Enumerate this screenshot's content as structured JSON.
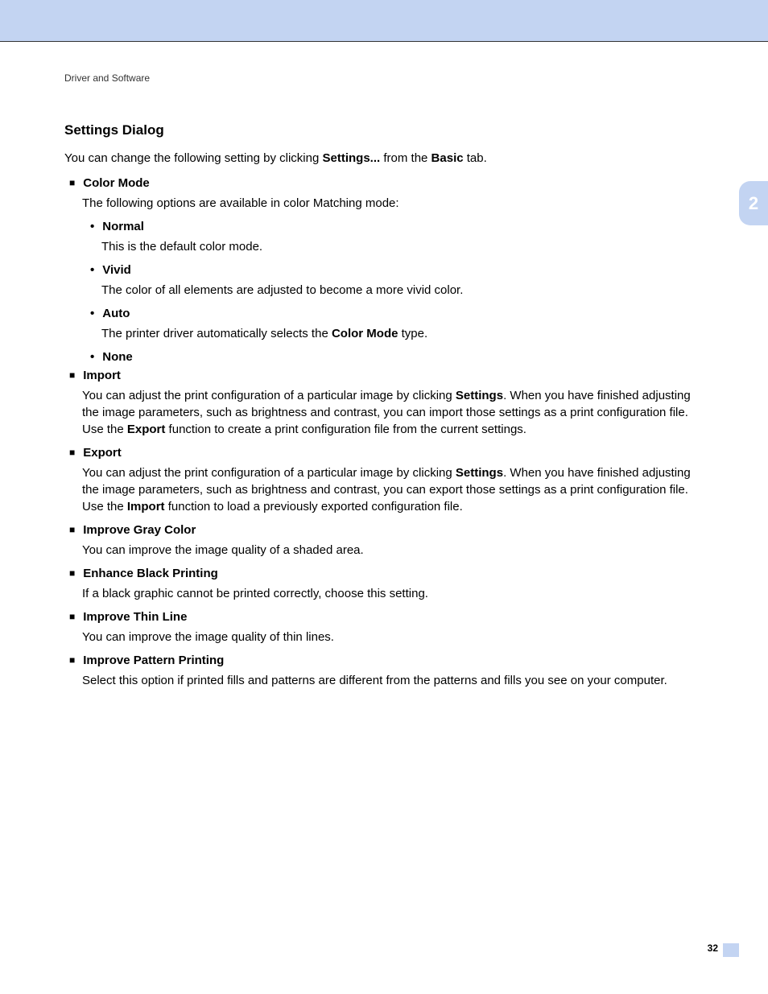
{
  "header": {
    "running": "Driver and Software"
  },
  "chapter_tab": "2",
  "page_number": "32",
  "section": {
    "title": "Settings Dialog",
    "intro": {
      "pre": "You can change the following setting by clicking ",
      "bold1": "Settings...",
      "mid": " from the ",
      "bold2": "Basic",
      "post": " tab."
    }
  },
  "items": {
    "color_mode": {
      "label": "Color Mode",
      "body": "The following options are available in color Matching mode:",
      "sub": {
        "normal": {
          "label": "Normal",
          "body": "This is the default color mode."
        },
        "vivid": {
          "label": "Vivid",
          "body": "The color of all elements are adjusted to become a more vivid color."
        },
        "auto": {
          "label": "Auto",
          "body_pre": "The printer driver automatically selects the ",
          "body_bold": "Color Mode",
          "body_post": " type."
        },
        "none": {
          "label": "None"
        }
      }
    },
    "import": {
      "label": "Import",
      "body_pre": "You can adjust the print configuration of a particular image by clicking ",
      "body_bold1": "Settings",
      "body_mid": ". When you have finished adjusting the image parameters, such as brightness and contrast, you can import those settings as a print configuration file. Use the ",
      "body_bold2": "Export",
      "body_post": " function to create a print configuration file from the current settings."
    },
    "export": {
      "label": "Export",
      "body_pre": "You can adjust the print configuration of a particular image by clicking ",
      "body_bold1": "Settings",
      "body_mid": ". When you have finished adjusting the image parameters, such as brightness and contrast, you can export those settings as a print configuration file. Use the ",
      "body_bold2": "Import",
      "body_post": " function to load a previously exported configuration file."
    },
    "improve_gray": {
      "label": "Improve Gray Color",
      "body": "You can improve the image quality of a shaded area."
    },
    "enhance_black": {
      "label": "Enhance Black Printing",
      "body": "If a black graphic cannot be printed correctly, choose this setting."
    },
    "improve_thin": {
      "label": "Improve Thin Line",
      "body": "You can improve the image quality of thin lines."
    },
    "improve_pattern": {
      "label": "Improve Pattern Printing",
      "body": "Select this option if printed fills and patterns are different from the patterns and fills you see on your computer."
    }
  }
}
